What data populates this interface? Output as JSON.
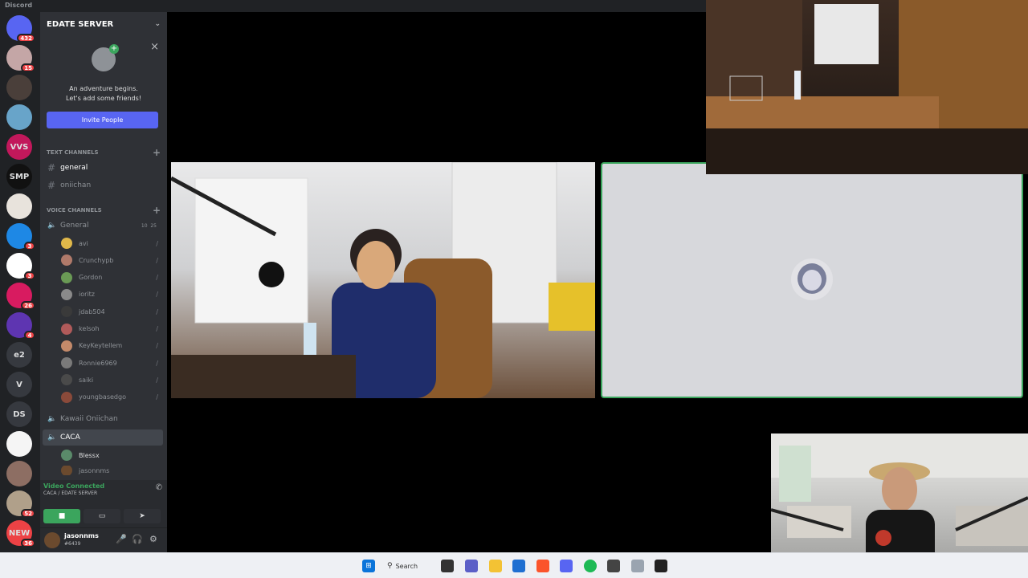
{
  "app": {
    "title": "Discord"
  },
  "servers": [
    {
      "label": "",
      "badge": "432",
      "color": "#5865f2"
    },
    {
      "label": "",
      "badge": "15",
      "color": "#c4a6a6"
    },
    {
      "label": "",
      "badge": "",
      "color": "#4a3f3a"
    },
    {
      "label": "",
      "badge": "",
      "color": "#68a4c9"
    },
    {
      "label": "VVS",
      "badge": "",
      "color": "#c2185b"
    },
    {
      "label": "SMP",
      "badge": "",
      "color": "#111111"
    },
    {
      "label": "",
      "badge": "",
      "color": "#e8e3dc"
    },
    {
      "label": "",
      "badge": "3",
      "color": "#1e88e5"
    },
    {
      "label": "",
      "badge": "3",
      "color": "#ffffff"
    },
    {
      "label": "",
      "badge": "26",
      "color": "#d81b60"
    },
    {
      "label": "",
      "badge": "4",
      "color": "#5e35b1"
    },
    {
      "label": "e2",
      "badge": "",
      "color": "#36393f"
    },
    {
      "label": "V",
      "badge": "",
      "color": "#36393f"
    },
    {
      "label": "DS",
      "badge": "",
      "color": "#36393f"
    },
    {
      "label": "",
      "badge": "",
      "color": "#f5f5f5"
    },
    {
      "label": "",
      "badge": "",
      "color": "#8d6e63"
    },
    {
      "label": "",
      "badge": "52",
      "color": "#b0a08a"
    },
    {
      "label": "NEW",
      "badge": "36",
      "color": "#ed4245"
    }
  ],
  "sidebar": {
    "server_name": "EDATE SERVER",
    "welcome_line1": "An adventure begins.",
    "welcome_line2": "Let's add some friends!",
    "invite_label": "Invite People",
    "text_category": "TEXT CHANNELS",
    "text_channels": [
      "general",
      "oniichan"
    ],
    "voice_category": "VOICE CHANNELS",
    "general_voice": {
      "name": "General",
      "count_a": "10",
      "count_b": "25"
    },
    "general_users": [
      {
        "name": "avi",
        "color": "#e0b84a"
      },
      {
        "name": "Crunchypb",
        "color": "#b07a6a"
      },
      {
        "name": "Gordon",
        "color": "#6a9a55"
      },
      {
        "name": "ioritz",
        "color": "#8a8a8a"
      },
      {
        "name": "jdab504",
        "color": "#3a3a3a"
      },
      {
        "name": "kelsoh",
        "color": "#b05a5a"
      },
      {
        "name": "KeyKeytellem",
        "color": "#c48a6a"
      },
      {
        "name": "Ronnie6969",
        "color": "#7a7a7a"
      },
      {
        "name": "saiki",
        "color": "#4a4a4a"
      },
      {
        "name": "youngbasedgo",
        "color": "#8a4a3a"
      }
    ],
    "kawaii_channel": "Kawaii Oniichan",
    "caca_channel": "CACA",
    "caca_users": [
      {
        "name": "Blessx",
        "color": "#5a8a6a"
      },
      {
        "name": "jasonnms",
        "color": "#6b4a2e"
      }
    ],
    "voice_status": "Video Connected",
    "voice_sub": "CACA / EDATE SERVER",
    "user_name": "jasonnms",
    "user_tag": "#6439"
  },
  "taskbar": {
    "search_label": "Search"
  }
}
